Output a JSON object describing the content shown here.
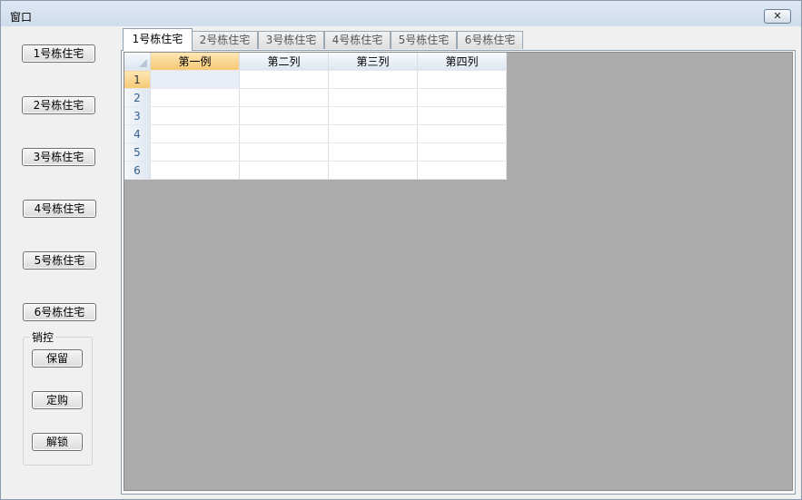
{
  "window": {
    "title": "窗口",
    "close_glyph": "✕"
  },
  "left_buttons": [
    "1号栋住宅",
    "2号栋住宅",
    "3号栋住宅",
    "4号栋住宅",
    "5号栋住宅",
    "6号栋住宅"
  ],
  "group": {
    "label": "销控",
    "buttons": [
      "保留",
      "定购",
      "解锁"
    ]
  },
  "tabs": [
    "1号栋住宅",
    "2号栋住宅",
    "3号栋住宅",
    "4号栋住宅",
    "5号栋住宅",
    "6号栋住宅"
  ],
  "active_tab": 0,
  "grid": {
    "columns": [
      "第一例",
      "第二列",
      "第三列",
      "第四列"
    ],
    "rows": [
      "1",
      "2",
      "3",
      "4",
      "5",
      "6"
    ],
    "selected_row": 0,
    "selected_col": 0
  }
}
